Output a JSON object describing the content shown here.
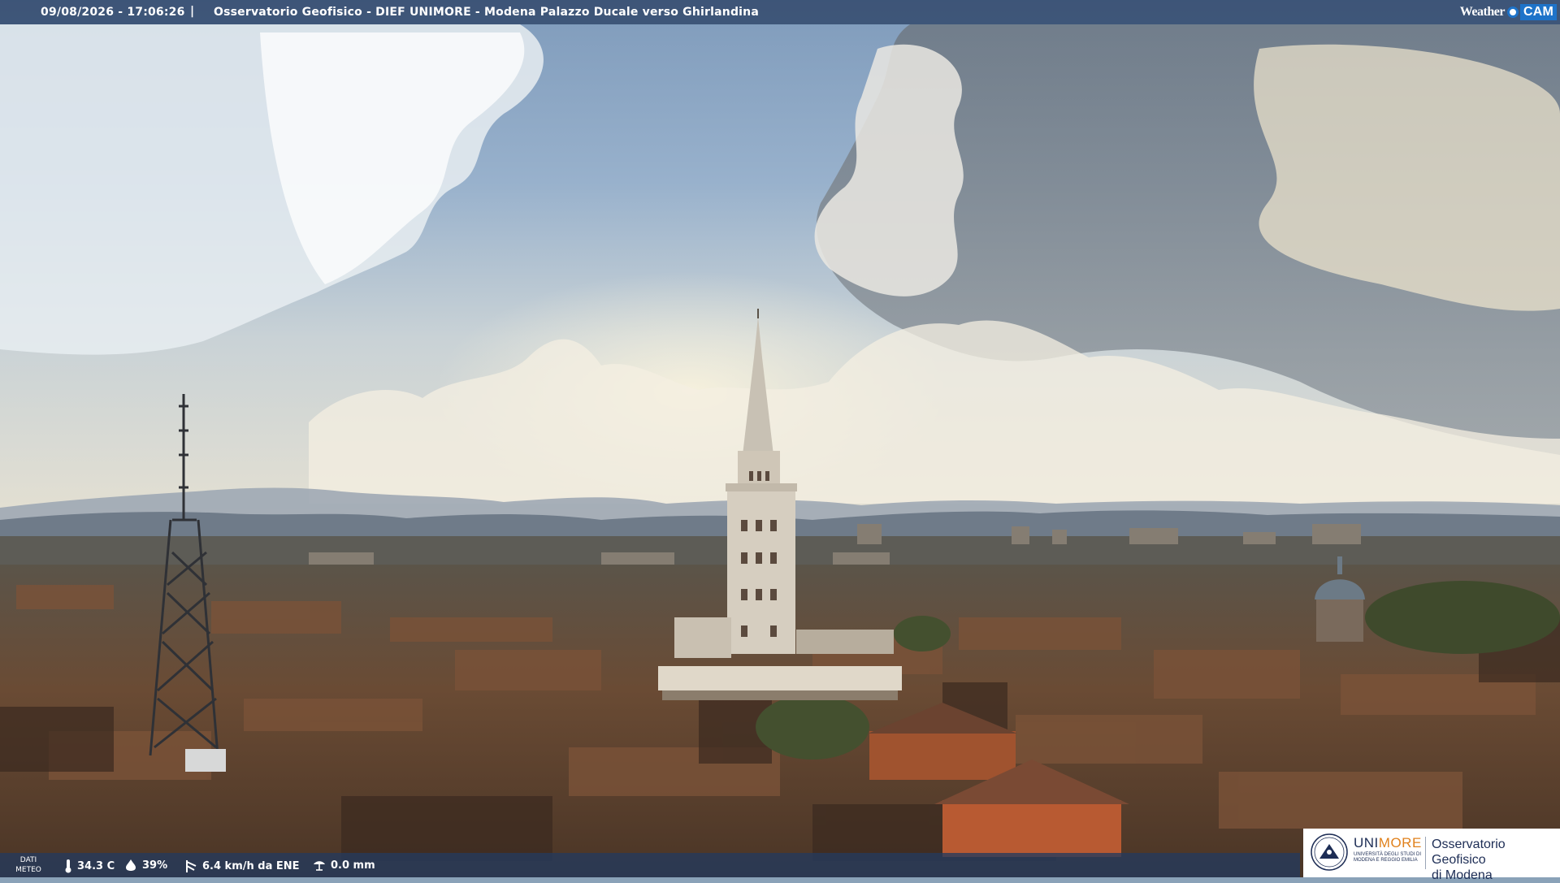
{
  "overlay": {
    "datetime": "09/08/2026 - 17:06:26",
    "separator": "|",
    "title": "Osservatorio Geofisico - DIEF UNIMORE - Modena Palazzo Ducale verso Ghirlandina",
    "brand_weather": "Weather",
    "brand_cam": "CAM"
  },
  "weather": {
    "dati_line1": "DATI",
    "dati_line2": "METEO",
    "temperature": "34.3 C",
    "humidity": "39%",
    "wind": "6.4 km/h da ENE",
    "rain": "0.0 mm",
    "icons": [
      "thermometer-icon",
      "humidity-drop-icon",
      "wind-icon",
      "rain-gauge-icon"
    ]
  },
  "logo": {
    "uni_a": "UNI",
    "uni_b": "MORE",
    "uni_sub1": "UNIVERSITÀ DEGLI STUDI DI",
    "uni_sub2": "MODENA E REGGIO EMILIA",
    "observatory_line1": "Osservatorio Geofisico",
    "observatory_line2": "di Modena"
  },
  "colors": {
    "overlay_bar": "#243a5e",
    "brand_blue": "#1e73c9",
    "logo_orange": "#e0811c",
    "logo_navy": "#1d2d55"
  }
}
